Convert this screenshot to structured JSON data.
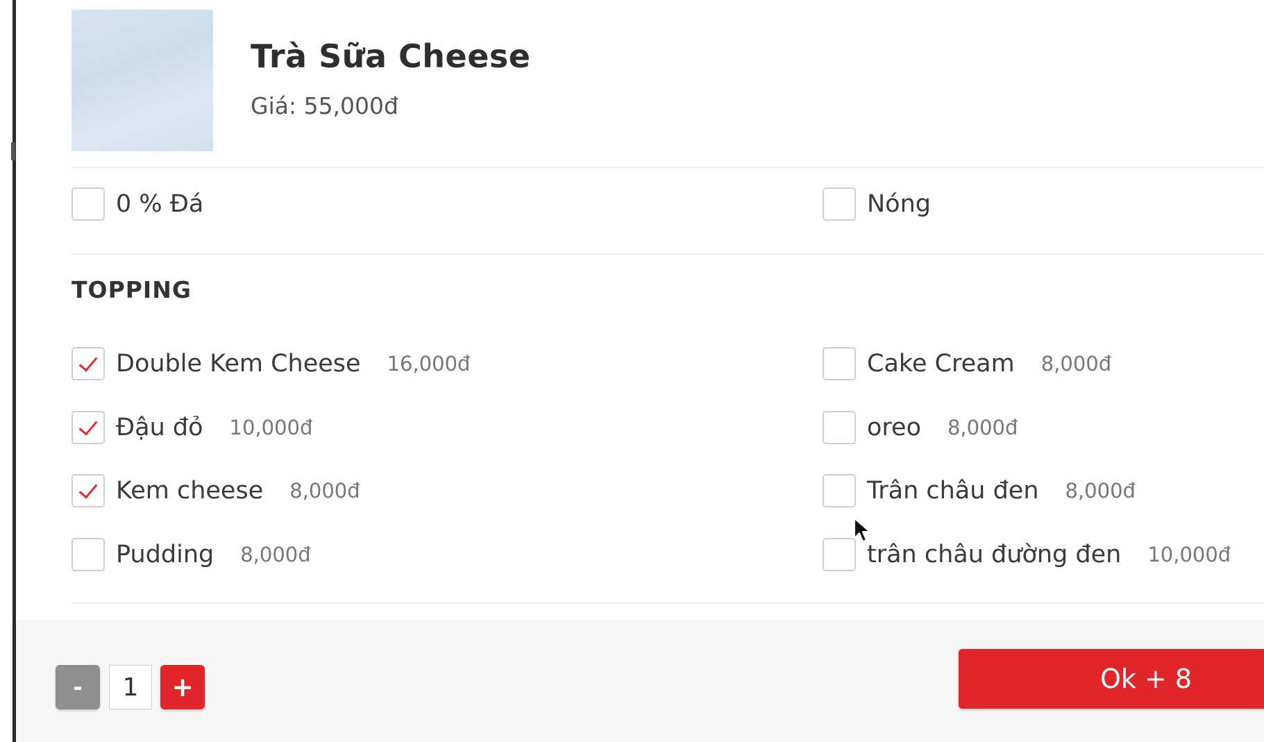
{
  "product": {
    "name": "Trà Sữa Cheese",
    "price": "Giá: 55,000đ"
  },
  "options": [
    {
      "label": "0 % Đá",
      "checked": false
    },
    {
      "label": "Nóng",
      "checked": false
    }
  ],
  "topping": {
    "title": "TOPPING",
    "items": [
      {
        "label": "Double Kem Cheese",
        "price": "16,000đ",
        "checked": true
      },
      {
        "label": "Cake Cream",
        "price": "8,000đ",
        "checked": false
      },
      {
        "label": "Đậu đỏ",
        "price": "10,000đ",
        "checked": true
      },
      {
        "label": "oreo",
        "price": "8,000đ",
        "checked": false
      },
      {
        "label": "Kem cheese",
        "price": "8,000đ",
        "checked": true
      },
      {
        "label": "Trân châu đen",
        "price": "8,000đ",
        "checked": false
      },
      {
        "label": "Pudding",
        "price": "8,000đ",
        "checked": false
      },
      {
        "label": "trân châu đường đen",
        "price": "10,000đ",
        "checked": false
      }
    ]
  },
  "footer": {
    "minus_label": "-",
    "quantity": "1",
    "plus_label": "+",
    "ok_label": "Ok + 8"
  },
  "colors": {
    "accent": "#e0262b",
    "minus_button": "#8f8f8f",
    "checkmark": "#e02d2d"
  }
}
